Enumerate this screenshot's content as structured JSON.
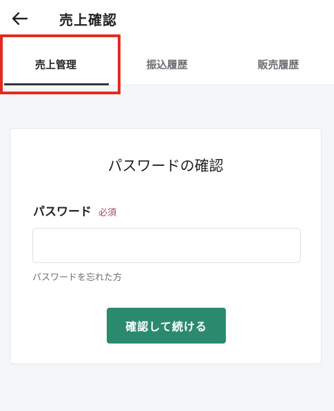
{
  "header": {
    "back_icon": "arrow-left-icon",
    "title": "売上確認"
  },
  "tabs": [
    {
      "label": "売上管理",
      "active": true
    },
    {
      "label": "振込履歴",
      "active": false
    },
    {
      "label": "販売履歴",
      "active": false
    }
  ],
  "card": {
    "title": "パスワードの確認",
    "password_label": "パスワード",
    "required_label": "必須",
    "password_value": "",
    "forgot_link": "パスワードを忘れた方",
    "submit_label": "確認して続ける"
  },
  "colors": {
    "accent": "#2b8a6e",
    "highlight": "#e32a1f",
    "required": "#a14472"
  }
}
